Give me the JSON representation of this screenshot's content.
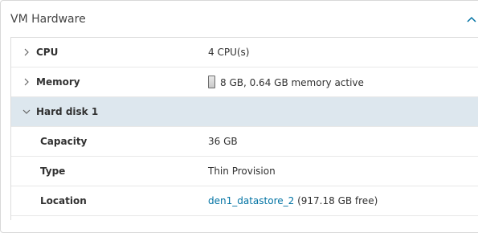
{
  "panel": {
    "title": "VM Hardware",
    "collapse_icon": "chevron-up-icon"
  },
  "rows": [
    {
      "label": "CPU",
      "value": "4 CPU(s)",
      "expanded": false,
      "icon": "chevron-right-icon"
    },
    {
      "label": "Memory",
      "value": "8 GB, 0.64 GB memory active",
      "expanded": false,
      "icon": "chevron-right-icon",
      "memory_active_fraction": 0.08
    },
    {
      "label": "Hard disk 1",
      "value": "",
      "expanded": true,
      "icon": "chevron-down-icon"
    }
  ],
  "hard_disk": {
    "capacity_label": "Capacity",
    "capacity_value": "36 GB",
    "type_label": "Type",
    "type_value": "Thin Provision",
    "location_label": "Location",
    "location_link": "den1_datastore_2",
    "location_free": " (917.18 GB free)"
  },
  "colors": {
    "selected_row": "#dde7ee",
    "link": "#0072a3",
    "accent": "#0072a3"
  }
}
